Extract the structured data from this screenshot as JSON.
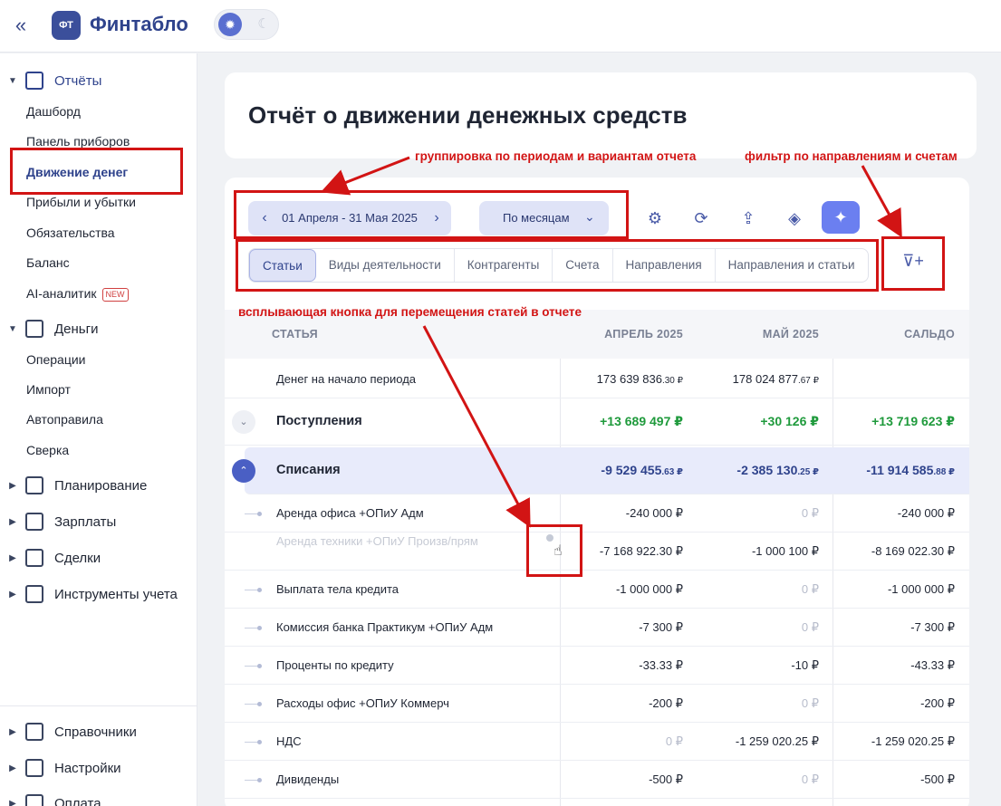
{
  "app": {
    "logo_badge": "ФТ",
    "logo_text": "Финтабло",
    "collapse_icon": "«"
  },
  "sidebar": {
    "reports_label": "Отчёты",
    "reports_items": [
      "Дашборд",
      "Панель приборов",
      "Движение денег",
      "Прибыли и убытки",
      "Обязательства",
      "Баланс",
      "AI-аналитик"
    ],
    "new_badge": "NEW",
    "money_label": "Деньги",
    "money_items": [
      "Операции",
      "Импорт",
      "Автоправила",
      "Сверка"
    ],
    "groups": [
      "Планирование",
      "Зарплаты",
      "Сделки",
      "Инструменты учета"
    ],
    "bottom_groups": [
      "Справочники",
      "Настройки",
      "Оплата"
    ]
  },
  "header": {
    "title": "Отчёт о движении денежных средств"
  },
  "toolbar": {
    "period": "01 Апреля - 31 Мая 2025",
    "grouping": "По месяцам",
    "icons": [
      "gear-icon",
      "refresh-icon",
      "upload-icon",
      "graduation-cap-icon",
      "sparkle-icon",
      "filter-plus-icon"
    ]
  },
  "tabs": [
    "Статьи",
    "Виды деятельности",
    "Контрагенты",
    "Счета",
    "Направления",
    "Направления и статьи"
  ],
  "table": {
    "columns": [
      "СТАТЬЯ",
      "АПРЕЛЬ 2025",
      "МАЙ 2025",
      "САЛЬДО"
    ],
    "opening": {
      "label": "Денег на начало периода",
      "apr": "173 639 836",
      "apr_dec": ".30 ₽",
      "may": "178 024 877",
      "may_dec": ".67 ₽"
    },
    "income": {
      "label": "Поступления",
      "apr": "+13 689 497 ₽",
      "may": "+30 126 ₽",
      "total": "+13 719 623 ₽"
    },
    "expenses": {
      "label": "Списания",
      "apr": "-9 529 455",
      "apr_dec": ".63 ₽",
      "may": "-2 385 130",
      "may_dec": ".25 ₽",
      "total": "-11 914 585",
      "total_dec": ".88 ₽"
    },
    "rows": [
      {
        "label": "Аренда офиса +ОПиУ Адм",
        "apr": "-240 000 ₽",
        "may": "0 ₽",
        "total": "-240 000 ₽"
      },
      {
        "label": "Аренда техники +ОПиУ Произв/прям",
        "apr": "-7 168 922.30 ₽",
        "may": "-1 000 100 ₽",
        "total": "-8 169 022.30 ₽"
      },
      {
        "label": "Выплата тела кредита",
        "apr": "-1 000 000 ₽",
        "may": "0 ₽",
        "total": "-1 000 000 ₽"
      },
      {
        "label": "Комиссия банка Практикум +ОПиУ Адм",
        "apr": "-7 300 ₽",
        "may": "0 ₽",
        "total": "-7 300 ₽"
      },
      {
        "label": "Проценты по кредиту",
        "apr": "-33.33 ₽",
        "may": "-10 ₽",
        "total": "-43.33 ₽"
      },
      {
        "label": "Расходы офис +ОПиУ Коммерч",
        "apr": "-200 ₽",
        "may": "0 ₽",
        "total": "-200 ₽"
      },
      {
        "label": "НДС",
        "apr": "0 ₽",
        "may": "-1 259 020.25 ₽",
        "total": "-1 259 020.25 ₽"
      },
      {
        "label": "Дивиденды",
        "apr": "-500 ₽",
        "may": "0 ₽",
        "total": "-500 ₽"
      }
    ]
  },
  "annotations": {
    "grouping_note": "группировка по периодам и вариантам отчета",
    "filter_note": "фильтр по направлениям и счетам",
    "move_note": "всплывающая кнопка для перемещения статей в отчете",
    "color": "#d21414"
  },
  "colors": {
    "brand": "#2f438c",
    "accent": "#6b7ff0",
    "positive": "#1f9a3c"
  }
}
